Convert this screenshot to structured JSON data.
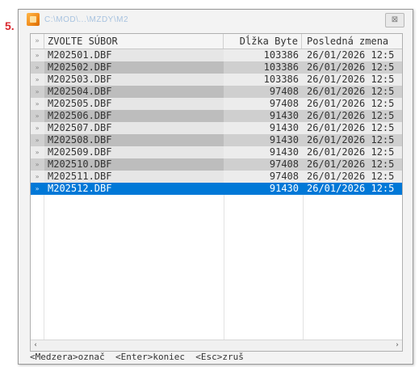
{
  "step_number": "5.",
  "window": {
    "title": "C:\\MOD\\...\\MZDY\\M2",
    "close_label": "⊠"
  },
  "columns": {
    "mark": "»",
    "name": "ZVOĽTE SÚBOR",
    "size": "Dĺžka Byte",
    "date": "Posledná zmena"
  },
  "files": [
    {
      "mark": "»",
      "name": "M202501.DBF",
      "size": "103386",
      "date": "26/01/2026 12:5"
    },
    {
      "mark": "»",
      "name": "M202502.DBF",
      "size": "103386",
      "date": "26/01/2026 12:5"
    },
    {
      "mark": "»",
      "name": "M202503.DBF",
      "size": "103386",
      "date": "26/01/2026 12:5"
    },
    {
      "mark": "»",
      "name": "M202504.DBF",
      "size": "97408",
      "date": "26/01/2026 12:5"
    },
    {
      "mark": "»",
      "name": "M202505.DBF",
      "size": "97408",
      "date": "26/01/2026 12:5"
    },
    {
      "mark": "»",
      "name": "M202506.DBF",
      "size": "91430",
      "date": "26/01/2026 12:5"
    },
    {
      "mark": "»",
      "name": "M202507.DBF",
      "size": "91430",
      "date": "26/01/2026 12:5"
    },
    {
      "mark": "»",
      "name": "M202508.DBF",
      "size": "91430",
      "date": "26/01/2026 12:5"
    },
    {
      "mark": "»",
      "name": "M202509.DBF",
      "size": "91430",
      "date": "26/01/2026 12:5"
    },
    {
      "mark": "»",
      "name": "M202510.DBF",
      "size": "97408",
      "date": "26/01/2026 12:5"
    },
    {
      "mark": "»",
      "name": "M202511.DBF",
      "size": "97408",
      "date": "26/01/2026 12:5"
    },
    {
      "mark": "»",
      "name": "M202512.DBF",
      "size": "91430",
      "date": "26/01/2026 12:5"
    }
  ],
  "selected_index": 11,
  "scrollbar": {
    "left_arrow": "‹",
    "right_arrow": "›"
  },
  "statusbar": {
    "text": "<Medzera>označ  <Enter>koniec  <Esc>zruš"
  },
  "colors": {
    "selection": "#0078d7",
    "step_number": "#d9272e"
  }
}
